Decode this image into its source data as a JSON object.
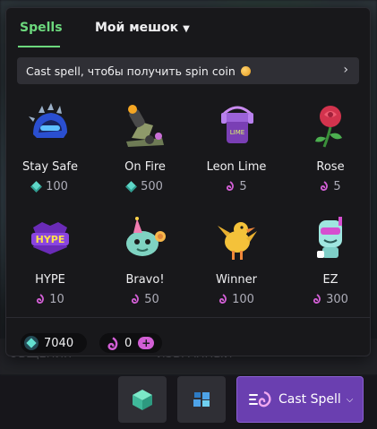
{
  "tabs": [
    {
      "label": "Spells",
      "active": true
    },
    {
      "label": "Мой мешок",
      "active": false
    }
  ],
  "banner": {
    "text": "Cast spell, чтобы получить spin coin"
  },
  "spells": [
    {
      "name": "Stay Safe",
      "price": "100",
      "currency": "blue-gem"
    },
    {
      "name": "On Fire",
      "price": "500",
      "currency": "blue-gem"
    },
    {
      "name": "Leon Lime",
      "price": "5",
      "currency": "pink-swirl"
    },
    {
      "name": "Rose",
      "price": "5",
      "currency": "pink-swirl"
    },
    {
      "name": "HYPE",
      "price": "10",
      "currency": "pink-swirl"
    },
    {
      "name": "Bravo!",
      "price": "50",
      "currency": "pink-swirl"
    },
    {
      "name": "Winner",
      "price": "100",
      "currency": "pink-swirl"
    },
    {
      "name": "EZ",
      "price": "300",
      "currency": "pink-swirl"
    }
  ],
  "balances": {
    "blue": "7040",
    "pink": "0"
  },
  "background": {
    "left_text": "ОБЩЕНИЯ",
    "mid_text": "ИЗБРАННЫЙ"
  },
  "cast_button": {
    "label": "Cast Spell"
  },
  "colors": {
    "accent_green": "#6cd87d",
    "cast_purple": "#6a3fb0",
    "pink_currency": "#d25fd5",
    "blue_currency": "#5fd7c8"
  }
}
